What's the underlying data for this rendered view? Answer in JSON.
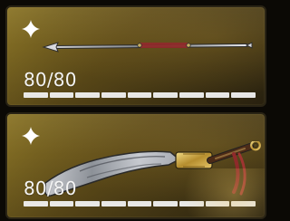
{
  "items": [
    {
      "icon": "spear-weapon-icon",
      "durability_text": "80/80",
      "durability_current": 80,
      "durability_max": 80,
      "durability_fraction": 1.0,
      "badge_icon": "four-point-star-icon",
      "colors": {
        "card_gradient_start": "#8a7426",
        "card_gradient_mid": "#5b4918",
        "card_gradient_end": "#2b2310",
        "bar_fill": "#ffffff",
        "accent_red": "#8f2a2a"
      }
    },
    {
      "icon": "broadsword-weapon-icon",
      "durability_text": "80/80",
      "durability_current": 80,
      "durability_max": 80,
      "durability_fraction": 1.0,
      "badge_icon": "four-point-star-icon",
      "colors": {
        "card_gradient_start": "#8a7426",
        "card_gradient_mid": "#5b4918",
        "card_gradient_end": "#2b2310",
        "bar_fill": "#ffffff",
        "accent_red": "#8f2a2a"
      }
    }
  ]
}
